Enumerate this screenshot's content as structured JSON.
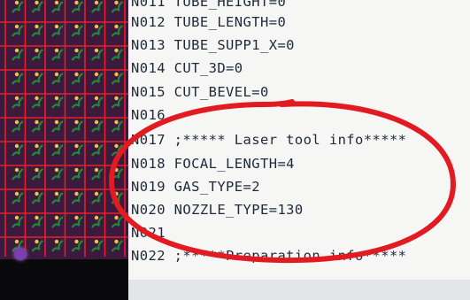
{
  "editor": {
    "lines": [
      "N011 TUBE_HEIGHT=0",
      "N012 TUBE_LENGTH=0",
      "N013 TUBE_SUPP1_X=0",
      "N014 CUT_3D=0",
      "N015 CUT_BEVEL=0",
      "N016",
      "N017 ;***** Laser tool info*****",
      "N018 FOCAL_LENGTH=4",
      "N019 GAS_TYPE=2",
      "N020 NOZZLE_TYPE=130",
      "N021",
      "N022 ;*****Preparation info*****"
    ]
  },
  "colors": {
    "annotation": "#e21b22",
    "grid_line": "#e3202a",
    "preview_bg": "#3c1a3e",
    "part_fill": "#1c8a3a"
  }
}
